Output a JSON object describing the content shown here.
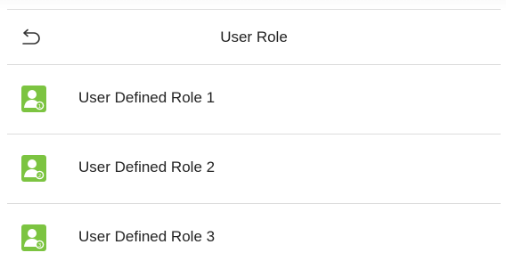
{
  "header": {
    "title": "User Role",
    "back_icon": "back-arrow-icon"
  },
  "roles": [
    {
      "label": "User Defined Role 1",
      "badge": "1",
      "icon": "user-role-icon"
    },
    {
      "label": "User Defined Role 2",
      "badge": "2",
      "icon": "user-role-icon"
    },
    {
      "label": "User Defined Role 3",
      "badge": "3",
      "icon": "user-role-icon"
    }
  ],
  "colors": {
    "icon_green": "#7cc441",
    "text": "#222222",
    "divider": "#dcdcdc"
  }
}
